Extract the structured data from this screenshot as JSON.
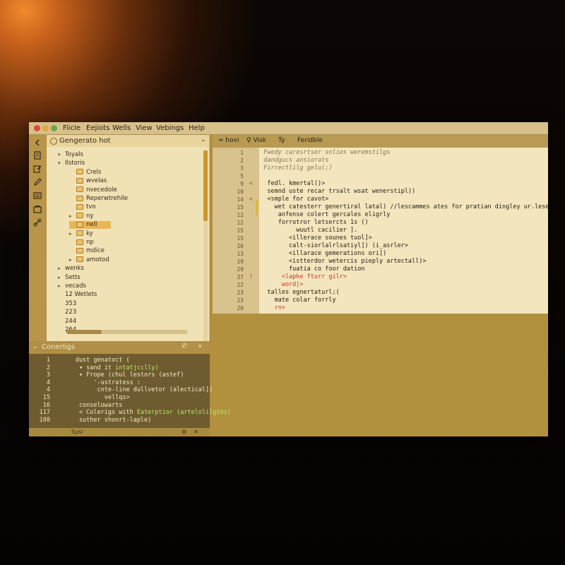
{
  "menubar": {
    "traffic_colors": [
      "#e0483e",
      "#e2a63a",
      "#6aa84f"
    ],
    "items": [
      "Fiicle",
      "Eejiots",
      "Wells",
      "View",
      "Vebings",
      "Help"
    ]
  },
  "activity_icons": [
    "chevron-left-icon",
    "files-icon",
    "edit-icon",
    "pen-icon",
    "document-icon",
    "package-icon",
    "link-icon"
  ],
  "explorer": {
    "title": "Gengerato hot",
    "rows": [
      {
        "label": "Toyals",
        "type": "section",
        "arrow": "▾",
        "indent": 0
      },
      {
        "label": "Ilstoris",
        "type": "section",
        "arrow": "▾",
        "indent": 0
      },
      {
        "label": "Crels",
        "type": "folder",
        "arrow": "",
        "indent": 1
      },
      {
        "label": "wvelas",
        "type": "folder",
        "arrow": "",
        "indent": 1
      },
      {
        "label": "nvecedole",
        "type": "folder",
        "arrow": "",
        "indent": 1
      },
      {
        "label": "Reperwtrehile",
        "type": "folder",
        "arrow": "",
        "indent": 1
      },
      {
        "label": "tvo",
        "type": "folder",
        "arrow": "",
        "indent": 1
      },
      {
        "label": "ny",
        "type": "folder",
        "arrow": "▸",
        "indent": 1
      },
      {
        "label": "nell",
        "type": "folder",
        "arrow": "",
        "indent": 1,
        "selected": true
      },
      {
        "label": "ky",
        "type": "folder",
        "arrow": "▸",
        "indent": 1
      },
      {
        "label": "np",
        "type": "folder",
        "arrow": "",
        "indent": 1
      },
      {
        "label": "mdice",
        "type": "folder",
        "arrow": "",
        "indent": 1
      },
      {
        "label": "amotod",
        "type": "folder",
        "arrow": "▸",
        "indent": 1
      },
      {
        "label": "wenks",
        "type": "item",
        "arrow": "▸",
        "indent": 0
      },
      {
        "label": "Setts",
        "type": "item",
        "arrow": "▸",
        "indent": 0
      },
      {
        "label": "vecads",
        "type": "item",
        "arrow": "▸",
        "indent": 0
      },
      {
        "label": "12 Wetlets",
        "type": "plain",
        "arrow": "",
        "indent": 0
      },
      {
        "label": "353",
        "type": "plain",
        "arrow": "",
        "indent": 0
      },
      {
        "label": "223",
        "type": "plain",
        "arrow": "",
        "indent": 0
      },
      {
        "label": "244",
        "type": "plain",
        "arrow": "",
        "indent": 0
      },
      {
        "label": "264",
        "type": "plain",
        "arrow": "",
        "indent": 0
      }
    ]
  },
  "editor": {
    "tabs": [
      "≈ hovi",
      "♀ Visk",
      "Ty",
      "Feridble"
    ],
    "lines": [
      {
        "num": "1",
        "marker": "",
        "text": "  Fwedy caresrtser snlies weremstilgs",
        "style": "faded"
      },
      {
        "num": "2",
        "marker": "",
        "text": "  dandgucs ansiorats",
        "style": "faded"
      },
      {
        "num": "3",
        "marker": "",
        "text": "  Firrectlilg gelu(;)",
        "style": "faded"
      },
      {
        "num": "5",
        "marker": "",
        "text": "",
        "style": ""
      },
      {
        "num": "9",
        "marker": "<",
        "text": "   fedl. kmertal()>",
        "style": ""
      },
      {
        "num": "10",
        "marker": "",
        "text": "   semnd uste recar trsalt wsat wenerstipl))",
        "style": ""
      },
      {
        "num": "14",
        "marker": "<",
        "text": "   <smple for cavot>",
        "style": ""
      },
      {
        "num": "15",
        "marker": "",
        "text": "     wet catesterr genertiral latal) //lescammes ates for pratian dingley ur.lese>",
        "style": ""
      },
      {
        "num": "12",
        "marker": "",
        "text": "      anfense colert gercales eligrly",
        "style": ""
      },
      {
        "num": "12",
        "marker": "",
        "text": "      forrotror letsercts 1s ()",
        "style": ""
      },
      {
        "num": "15",
        "marker": "",
        "text": "           wuutl cacilier ].",
        "style": ""
      },
      {
        "num": "15",
        "marker": "",
        "text": "         <illerace sounes tuol]>",
        "style": ""
      },
      {
        "num": "16",
        "marker": "",
        "text": "         calt-siorlalrlsatiyl]) (i_asrler>",
        "style": ""
      },
      {
        "num": "13",
        "marker": "",
        "text": "         <illarace gemerations ori])",
        "style": ""
      },
      {
        "num": "19",
        "marker": "",
        "text": "         <istterdor wetercis pieply artectall)>",
        "style": ""
      },
      {
        "num": "29",
        "marker": "",
        "text": "         fuatia co foor dation",
        "style": ""
      },
      {
        "num": "37",
        "marker": "!",
        "text": "       <lapke fturr gilr>",
        "style": "red"
      },
      {
        "num": "22",
        "marker": "",
        "text": "       word|>",
        "style": "red"
      },
      {
        "num": "23",
        "marker": "",
        "text": "   talles egnertaturl;(",
        "style": ""
      },
      {
        "num": "23",
        "marker": "",
        "text": "     mate colar forrly",
        "style": ""
      },
      {
        "num": "20",
        "marker": "",
        "text": "     rn>",
        "style": "red"
      }
    ]
  },
  "panel": {
    "title": "Conerligs",
    "icons": [
      "phone-icon",
      "close-icon"
    ],
    "lines": [
      {
        "num": "1",
        "text": "       dust genatoct (",
        "hl": ""
      },
      {
        "num": "2",
        "text": "        ▾ sand it ",
        "hl": "intatjcclly)"
      },
      {
        "num": "3",
        "text": "        ▾ Frope (chul lestors (astef)",
        "hl": ""
      },
      {
        "num": "4",
        "text": "            '-ustratess :",
        "hl": ""
      },
      {
        "num": "4",
        "text": "             cnte-line dullvetor (alectical])",
        "hl": ""
      },
      {
        "num": "15",
        "text": "               vellqs>",
        "hl": ""
      },
      {
        "num": "16",
        "text": "        conselowarts",
        "hl": ""
      },
      {
        "num": "117",
        "text": "        < Colerigs with ",
        "hl": "Eaterptior (artelolilgtes)"
      },
      {
        "num": "108",
        "text": "        suther shonrt-laple)",
        "hl": ""
      }
    ],
    "status": {
      "label": "Sysl",
      "icons": [
        "gear-icon",
        "close-icon"
      ]
    }
  }
}
